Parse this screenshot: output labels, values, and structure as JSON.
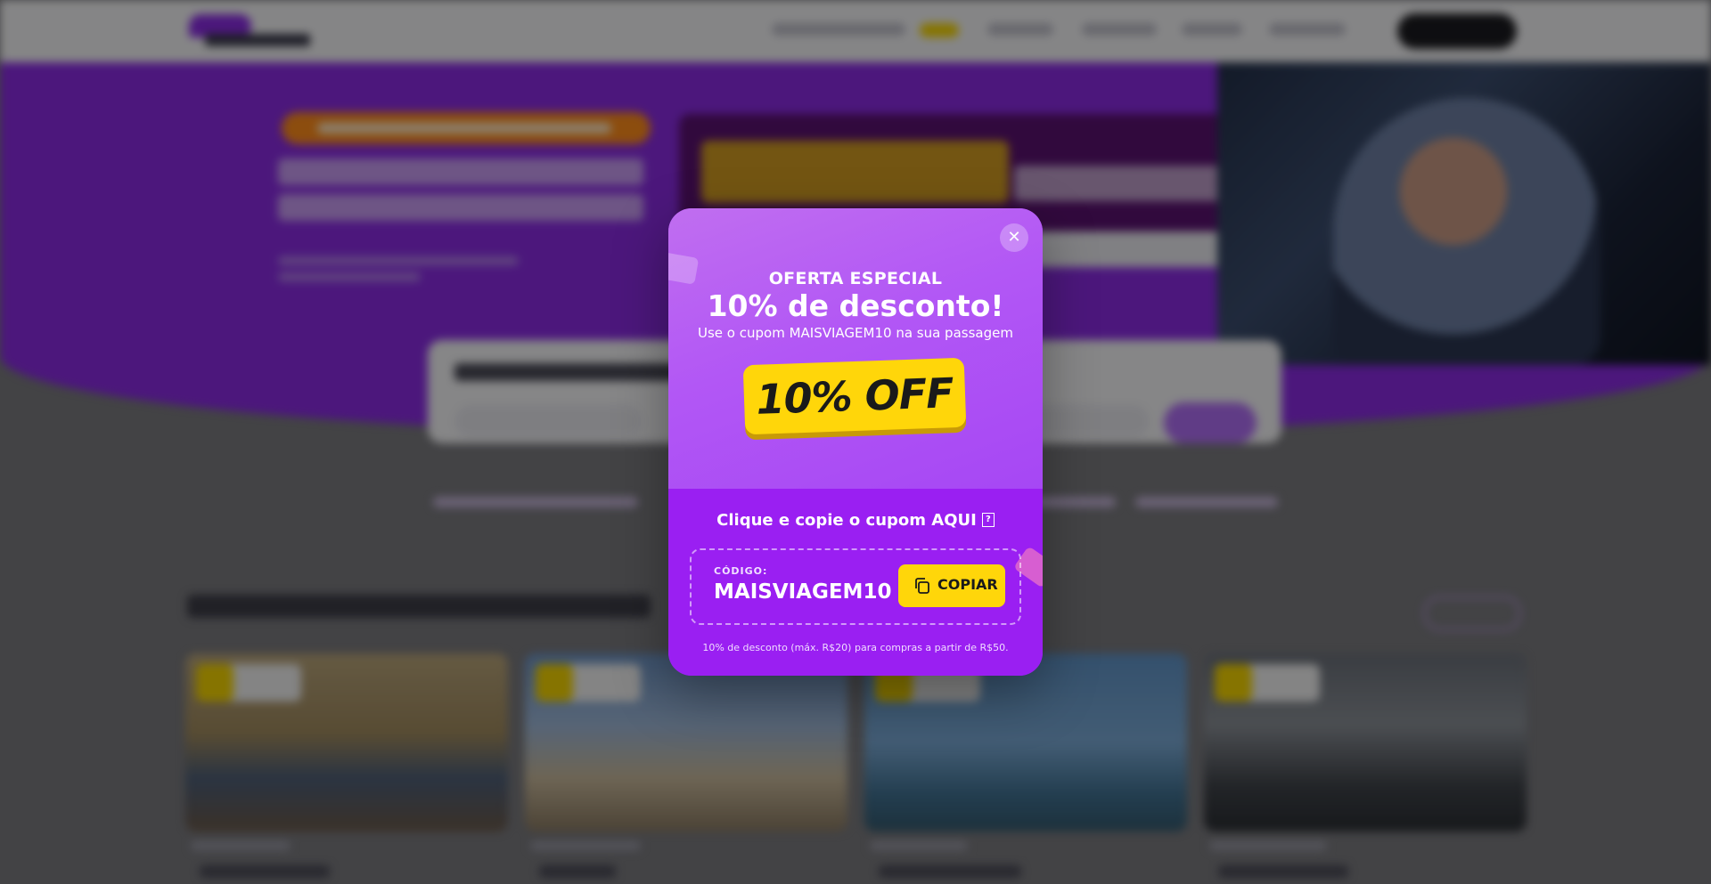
{
  "modal": {
    "kicker": "OFERTA ESPECIAL",
    "headline": "10% de desconto!",
    "subline": "Use o cupom MAISVIAGEM10 na sua passagem",
    "badge": "10% OFF",
    "cta": "Clique e copie o cupom AQUI",
    "help_glyph": "?",
    "code_label": "CÓDIGO:",
    "code_value": "MAISVIAGEM10",
    "copy_label": "COPIAR",
    "close_glyph": "✕",
    "footnote": "10% de desconto (máx. R$20) para compras a partir de R$50."
  },
  "colors": {
    "accent_purple": "#9a1ff2",
    "badge_yellow": "#ffd60a",
    "overlay": "rgba(0,0,0,0.45)"
  },
  "icons": {
    "close": "close-icon",
    "copy": "copy-icon"
  }
}
